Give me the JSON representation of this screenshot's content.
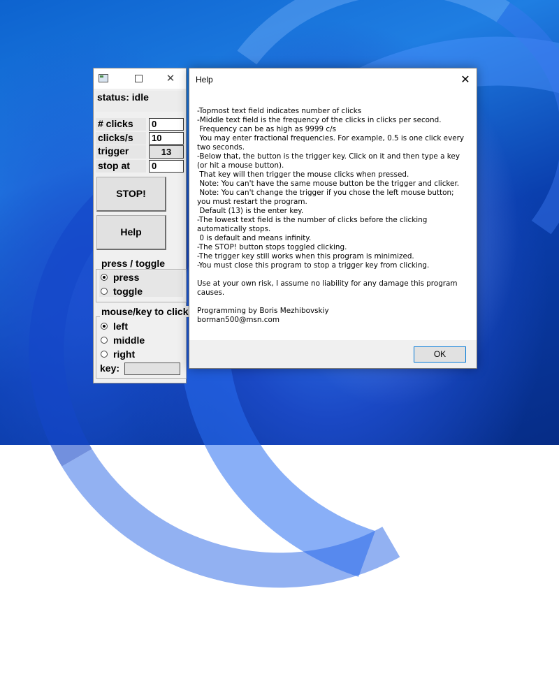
{
  "clicker": {
    "status": "status: idle",
    "clicks_label": "# clicks",
    "clicks_value": "0",
    "cps_label": "clicks/s",
    "cps_value": "10",
    "trigger_label": "trigger",
    "trigger_value": "13",
    "stopat_label": "stop at",
    "stopat_value": "0",
    "stop_button": "STOP!",
    "help_button": "Help",
    "mode_group": {
      "title": "press / toggle",
      "options": [
        "press",
        "toggle"
      ],
      "selected": "press"
    },
    "button_group": {
      "title": "mouse/key to click",
      "options": [
        "left",
        "middle",
        "right"
      ],
      "selected": "left"
    },
    "key_label": "key:"
  },
  "help": {
    "title": "Help",
    "lines": [
      "-Topmost text field indicates number of clicks",
      "-Middle text field is the frequency of the clicks in clicks per second.",
      " Frequency can be as high as 9999 c/s",
      " You may enter fractional frequencies. For example, 0.5 is one click every",
      "two seconds.",
      "-Below that, the button is the trigger key. Click on it and then type a key",
      "(or hit a mouse button).",
      " That key will then trigger the mouse clicks when pressed.",
      " Note: You can't have the same mouse button be the trigger and clicker.",
      " Note: You can't change the trigger if you chose the left mouse button;",
      "you must restart the program.",
      " Default (13) is the enter key.",
      "-The lowest text field is the number of clicks before the clicking",
      "automatically stops.",
      " 0 is default and means infinity.",
      "-The STOP! button stops toggled clicking.",
      "-The trigger key still works when this program is minimized.",
      "-You must close this program to stop a trigger key from clicking.",
      "",
      "Use at your own risk, I assume no liability for any damage this program",
      "causes.",
      "",
      "Programming by Boris Mezhibovskiy",
      "borman500@msn.com"
    ],
    "ok_button": "OK"
  }
}
